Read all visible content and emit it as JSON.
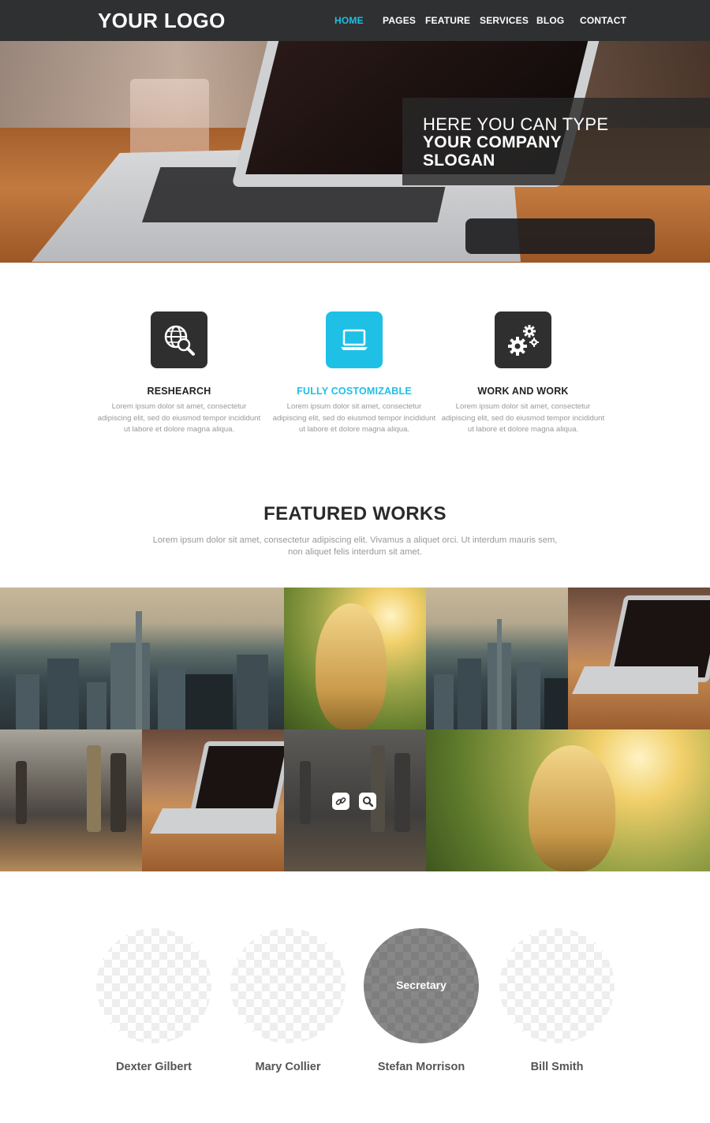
{
  "header": {
    "logo": "YOUR LOGO",
    "nav": [
      {
        "label": "HOME",
        "active": true
      },
      {
        "label": "PAGES",
        "active": false
      },
      {
        "label": "FEATURE",
        "active": false
      },
      {
        "label": "SERVICES",
        "active": false
      },
      {
        "label": "BLOG",
        "active": false
      },
      {
        "label": "CONTACT",
        "active": false
      }
    ]
  },
  "hero": {
    "slogan_line1": "HERE YOU CAN TYPE",
    "slogan_line2": "YOUR COMPANY",
    "slogan_line3": "SLOGAN",
    "slides": 3,
    "active_slide": 2
  },
  "features": [
    {
      "title": "RESHEARCH",
      "icon": "globe-search-icon",
      "text": "Lorem ipsum dolor sit amet, consectetur adipiscing elit, sed do eiusmod tempor incididunt ut labore et dolore magna aliqua."
    },
    {
      "title": "FULLY COSTOMIZABLE",
      "icon": "laptop-icon",
      "text": "Lorem ipsum dolor sit amet, consectetur adipiscing elit, sed do eiusmod tempor incididunt ut labore et dolore magna aliqua."
    },
    {
      "title": "WORK AND WORK",
      "icon": "gears-icon",
      "text": "Lorem ipsum dolor sit amet, consectetur adipiscing elit, sed do eiusmod tempor incididunt ut labore et dolore magna aliqua."
    }
  ],
  "featured_works": {
    "title": "FEATURED WORKS",
    "description": "Lorem ipsum dolor sit amet, consectetur adipiscing elit. Vivamus a aliquet orci. Ut interdum mauris sem, non aliquet felis interdum sit amet.",
    "items": [
      "city",
      "girl-field",
      "city",
      "laptop",
      "train",
      "laptop",
      "train",
      "girl-field"
    ],
    "hover_actions": [
      "link-icon",
      "search-icon"
    ]
  },
  "team": [
    {
      "name": "Dexter Gilbert",
      "role": ""
    },
    {
      "name": "Mary Collier",
      "role": ""
    },
    {
      "name": "Stefan Morrison",
      "role": "Secretary"
    },
    {
      "name": "Bill Smith",
      "role": ""
    }
  ],
  "colors": {
    "accent": "#1ec0e6",
    "header_bg": "#2f3031",
    "dark_icon": "#2f2f2f"
  }
}
